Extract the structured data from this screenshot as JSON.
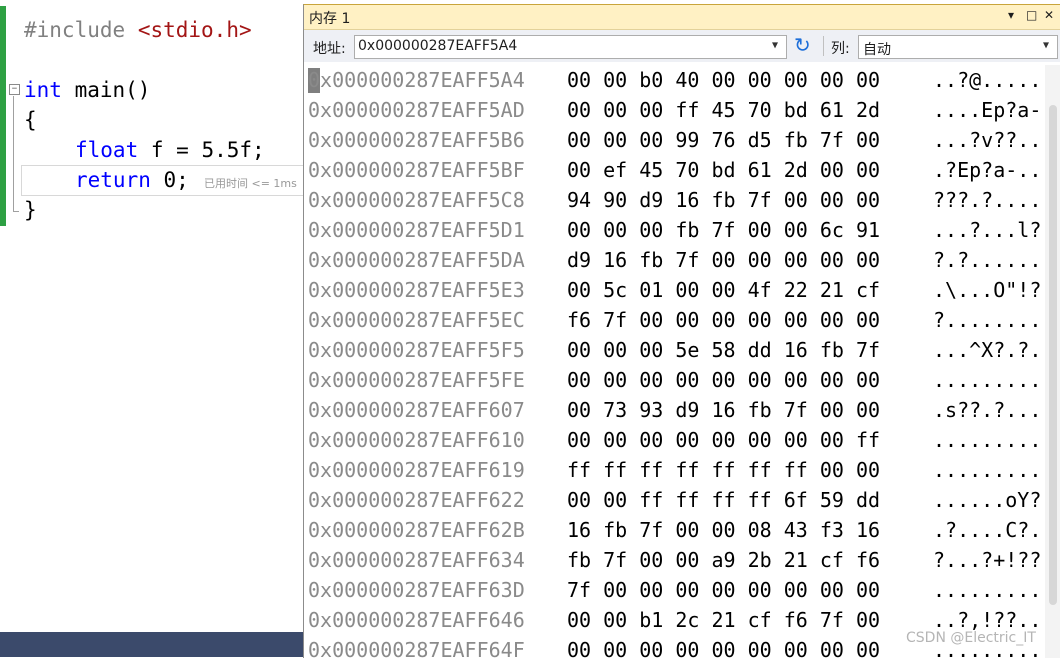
{
  "editor": {
    "lines": {
      "include_directive": "#include",
      "include_header": "<stdio.h>",
      "main_type": "int",
      "main_sig": "main()",
      "open_brace": "{",
      "float_kw": "float",
      "float_rest": "f = 5.5f;",
      "return_kw": "return",
      "return_rest": "0;",
      "close_brace": "}"
    },
    "perf_hint": "已用时间 <= 1ms"
  },
  "memory_window": {
    "title": "内存 1",
    "title_buttons": {
      "dropdown": "▾",
      "restore": "□",
      "close": "✕"
    },
    "address_label": "地址:",
    "address_value": "0x000000287EAFF5A4",
    "column_label": "列:",
    "column_value": "自动",
    "rows": [
      {
        "addr": "0x000000287EAFF5A4",
        "bytes": "00 00 b0 40 00 00 00 00 00",
        "ascii": "..?@....."
      },
      {
        "addr": "0x000000287EAFF5AD",
        "bytes": "00 00 00 ff 45 70 bd 61 2d",
        "ascii": "....Ep?a-"
      },
      {
        "addr": "0x000000287EAFF5B6",
        "bytes": "00 00 00 99 76 d5 fb 7f 00",
        "ascii": "...?v??.."
      },
      {
        "addr": "0x000000287EAFF5BF",
        "bytes": "00 ef 45 70 bd 61 2d 00 00",
        "ascii": ".?Ep?a-.."
      },
      {
        "addr": "0x000000287EAFF5C8",
        "bytes": "94 90 d9 16 fb 7f 00 00 00",
        "ascii": "???.?...."
      },
      {
        "addr": "0x000000287EAFF5D1",
        "bytes": "00 00 00 fb 7f 00 00 6c 91",
        "ascii": "...?...l?"
      },
      {
        "addr": "0x000000287EAFF5DA",
        "bytes": "d9 16 fb 7f 00 00 00 00 00",
        "ascii": "?.?......"
      },
      {
        "addr": "0x000000287EAFF5E3",
        "bytes": "00 5c 01 00 00 4f 22 21 cf",
        "ascii": ".\\...O\"!?"
      },
      {
        "addr": "0x000000287EAFF5EC",
        "bytes": "f6 7f 00 00 00 00 00 00 00",
        "ascii": "?........"
      },
      {
        "addr": "0x000000287EAFF5F5",
        "bytes": "00 00 00 5e 58 dd 16 fb 7f",
        "ascii": "...^X?.?."
      },
      {
        "addr": "0x000000287EAFF5FE",
        "bytes": "00 00 00 00 00 00 00 00 00",
        "ascii": "........."
      },
      {
        "addr": "0x000000287EAFF607",
        "bytes": "00 73 93 d9 16 fb 7f 00 00",
        "ascii": ".s??.?..."
      },
      {
        "addr": "0x000000287EAFF610",
        "bytes": "00 00 00 00 00 00 00 00 ff",
        "ascii": "........."
      },
      {
        "addr": "0x000000287EAFF619",
        "bytes": "ff ff ff ff ff ff ff 00 00",
        "ascii": "........."
      },
      {
        "addr": "0x000000287EAFF622",
        "bytes": "00 00 ff ff ff ff 6f 59 dd",
        "ascii": "......oY?"
      },
      {
        "addr": "0x000000287EAFF62B",
        "bytes": "16 fb 7f 00 00 08 43 f3 16",
        "ascii": ".?....C?."
      },
      {
        "addr": "0x000000287EAFF634",
        "bytes": "fb 7f 00 00 a9 2b 21 cf f6",
        "ascii": "?...?+!??"
      },
      {
        "addr": "0x000000287EAFF63D",
        "bytes": "7f 00 00 00 00 00 00 00 00",
        "ascii": "........."
      },
      {
        "addr": "0x000000287EAFF646",
        "bytes": "00 00 b1 2c 21 cf f6 7f 00",
        "ascii": "..?,!??.."
      },
      {
        "addr": "0x000000287EAFF64F",
        "bytes": "00 00 00 00 00 00 00 00 00",
        "ascii": "........."
      }
    ]
  },
  "watermark": "CSDN @Electric_IT"
}
